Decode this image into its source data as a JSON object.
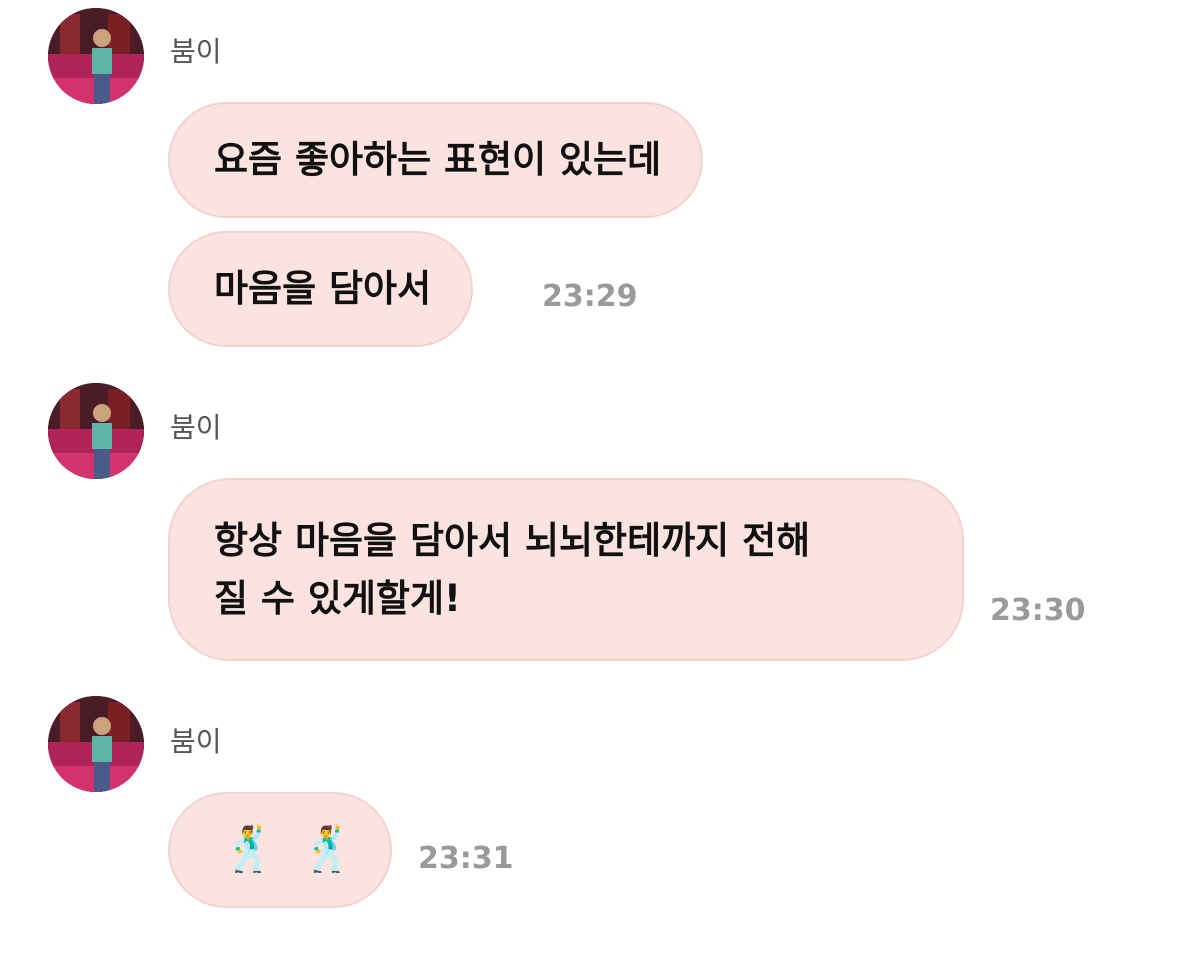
{
  "groups": [
    {
      "sender": "붐이",
      "messages": [
        {
          "text": "요즘 좋아하는 표현이 있는데"
        },
        {
          "text": "마음을 담아서",
          "time": "23:29"
        }
      ]
    },
    {
      "sender": "붐이",
      "messages": [
        {
          "line1": "항상 마음을 담아서 뇌뇌한테까지 전해",
          "line2": "질 수 있게할게!",
          "time": "23:30"
        }
      ]
    },
    {
      "sender": "붐이",
      "messages": [
        {
          "emoji1": "🕺",
          "emoji2": "🕺",
          "time": "23:31"
        }
      ]
    }
  ],
  "colors": {
    "bubble_bg": "#fbe3df",
    "bubble_border": "#f3d3cd",
    "time_text": "#9a9a9a",
    "sender_text": "#555555"
  },
  "icons": {
    "avatar": "profile-photo-avatar"
  }
}
